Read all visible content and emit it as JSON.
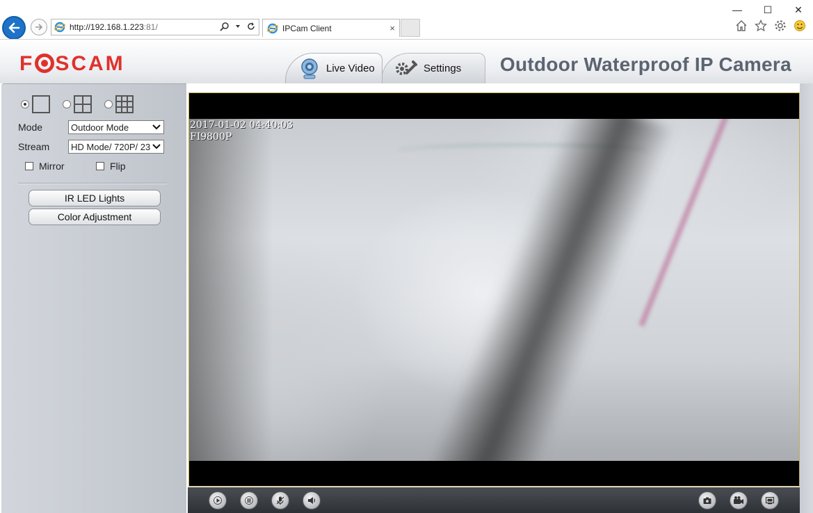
{
  "browser": {
    "address_host": "http://192.168.1.223",
    "address_port": ":81/",
    "tab_title": "IPCam Client",
    "tab_close": "×",
    "window_controls": [
      "—",
      "☐",
      "✕"
    ]
  },
  "header": {
    "logo_text_1": "F",
    "logo_text_2": "SCAM",
    "tabs": [
      {
        "label": "Live Video",
        "icon": "webcam-icon",
        "active": true
      },
      {
        "label": "Settings",
        "icon": "wrench-gear-icon",
        "active": false
      }
    ],
    "model_title": "Outdoor Waterproof IP Camera"
  },
  "left_panel": {
    "layout_options": [
      {
        "grid": "1x1",
        "checked": true
      },
      {
        "grid": "2x2",
        "checked": false
      },
      {
        "grid": "3x3",
        "checked": false
      }
    ],
    "mode": {
      "label": "Mode",
      "value": "Outdoor Mode"
    },
    "stream": {
      "label": "Stream",
      "value": "HD Mode/ 720P/ 23"
    },
    "mirror_label": "Mirror",
    "flip_label": "Flip",
    "ir_led_button": "IR LED Lights",
    "color_adjust_button": "Color Adjustment"
  },
  "video": {
    "osd_timestamp": "2017-01-02 04:40:03",
    "osd_model": "FI9800P"
  },
  "control_bar": {
    "left_buttons": [
      "play-icon",
      "pause-icon",
      "microphone-icon",
      "speaker-icon"
    ],
    "right_buttons": [
      "snapshot-icon",
      "record-icon",
      "fullscreen-icon"
    ]
  },
  "colors": {
    "logo_red": "#e0312b",
    "back_button_blue": "#1e73c8",
    "video_border": "#c5ae5a",
    "title_gray": "#5b6470"
  }
}
